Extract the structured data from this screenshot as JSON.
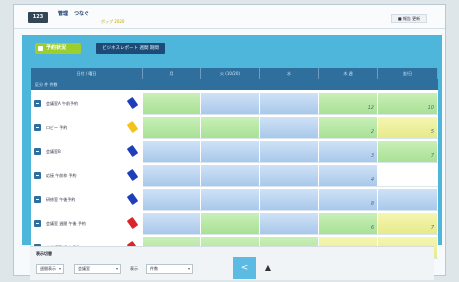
{
  "topbar": {
    "app_badge": "123",
    "brand_main": "管理",
    "brand_sub": "つなぐ",
    "brand_tag": "ポップ 2020",
    "user_button": "■ 報告 更新"
  },
  "panel": {
    "title": "予約状況",
    "subtitle": "ビジネスレポート 週間 期間"
  },
  "table": {
    "columns": [
      {
        "label": "日付 / 曜日"
      },
      {
        "label": "月"
      },
      {
        "label": "火 (10/20)"
      },
      {
        "label": "水"
      },
      {
        "label": "木 週"
      },
      {
        "label": "金/日"
      }
    ],
    "sub_header": "区分   件   件数",
    "rows": [
      {
        "label": "会議室A 午前予約",
        "tag_color": "#1f3fb8",
        "cells": [
          {
            "kind": "green",
            "value": ""
          },
          {
            "kind": "blue",
            "value": ""
          },
          {
            "kind": "blue",
            "value": ""
          },
          {
            "kind": "green",
            "value": "12"
          },
          {
            "kind": "green",
            "value": "10"
          }
        ]
      },
      {
        "label": "ロビー 予約",
        "tag_color": "#f3c319",
        "cells": [
          {
            "kind": "green",
            "value": ""
          },
          {
            "kind": "green",
            "value": ""
          },
          {
            "kind": "blue",
            "value": ""
          },
          {
            "kind": "green",
            "value": "2"
          },
          {
            "kind": "yellow",
            "value": "5"
          }
        ]
      },
      {
        "label": "会議室B",
        "tag_color": "#1f3fb8",
        "cells": [
          {
            "kind": "blue",
            "value": ""
          },
          {
            "kind": "blue",
            "value": ""
          },
          {
            "kind": "blue",
            "value": ""
          },
          {
            "kind": "blue",
            "value": "3"
          },
          {
            "kind": "green",
            "value": "7"
          }
        ]
      },
      {
        "label": "応接 午前枠 予約",
        "tag_color": "#1f3fb8",
        "cells": [
          {
            "kind": "blue",
            "value": ""
          },
          {
            "kind": "blue",
            "value": ""
          },
          {
            "kind": "blue",
            "value": ""
          },
          {
            "kind": "blue",
            "value": "4"
          },
          {
            "kind": "white",
            "value": ""
          }
        ]
      },
      {
        "label": "研修室 午後予約",
        "tag_color": "#1f3fb8",
        "cells": [
          {
            "kind": "blue",
            "value": ""
          },
          {
            "kind": "blue",
            "value": ""
          },
          {
            "kind": "blue",
            "value": ""
          },
          {
            "kind": "blue",
            "value": "8"
          },
          {
            "kind": "blue",
            "value": ""
          }
        ]
      },
      {
        "label": "会議室 週間 午後 予約",
        "tag_color": "#d8262b",
        "cells": [
          {
            "kind": "blue",
            "value": ""
          },
          {
            "kind": "green",
            "value": ""
          },
          {
            "kind": "blue",
            "value": ""
          },
          {
            "kind": "green",
            "value": "6"
          },
          {
            "kind": "yellow",
            "value": "7"
          }
        ]
      },
      {
        "label": "大会議室 週末 予約",
        "tag_color": "#d8262b",
        "cells": [
          {
            "kind": "green",
            "value": ""
          },
          {
            "kind": "green",
            "value": ""
          },
          {
            "kind": "green",
            "value": ""
          },
          {
            "kind": "yellow",
            "value": "5"
          },
          {
            "kind": "yellow",
            "value": "4"
          }
        ]
      }
    ]
  },
  "bottom": {
    "title": "表示切替",
    "select1": "週間表示",
    "select2": "会議室",
    "label1": "表示",
    "select3": "件数",
    "share_icon": "share-icon",
    "up_icon": "arrow-up-icon"
  }
}
